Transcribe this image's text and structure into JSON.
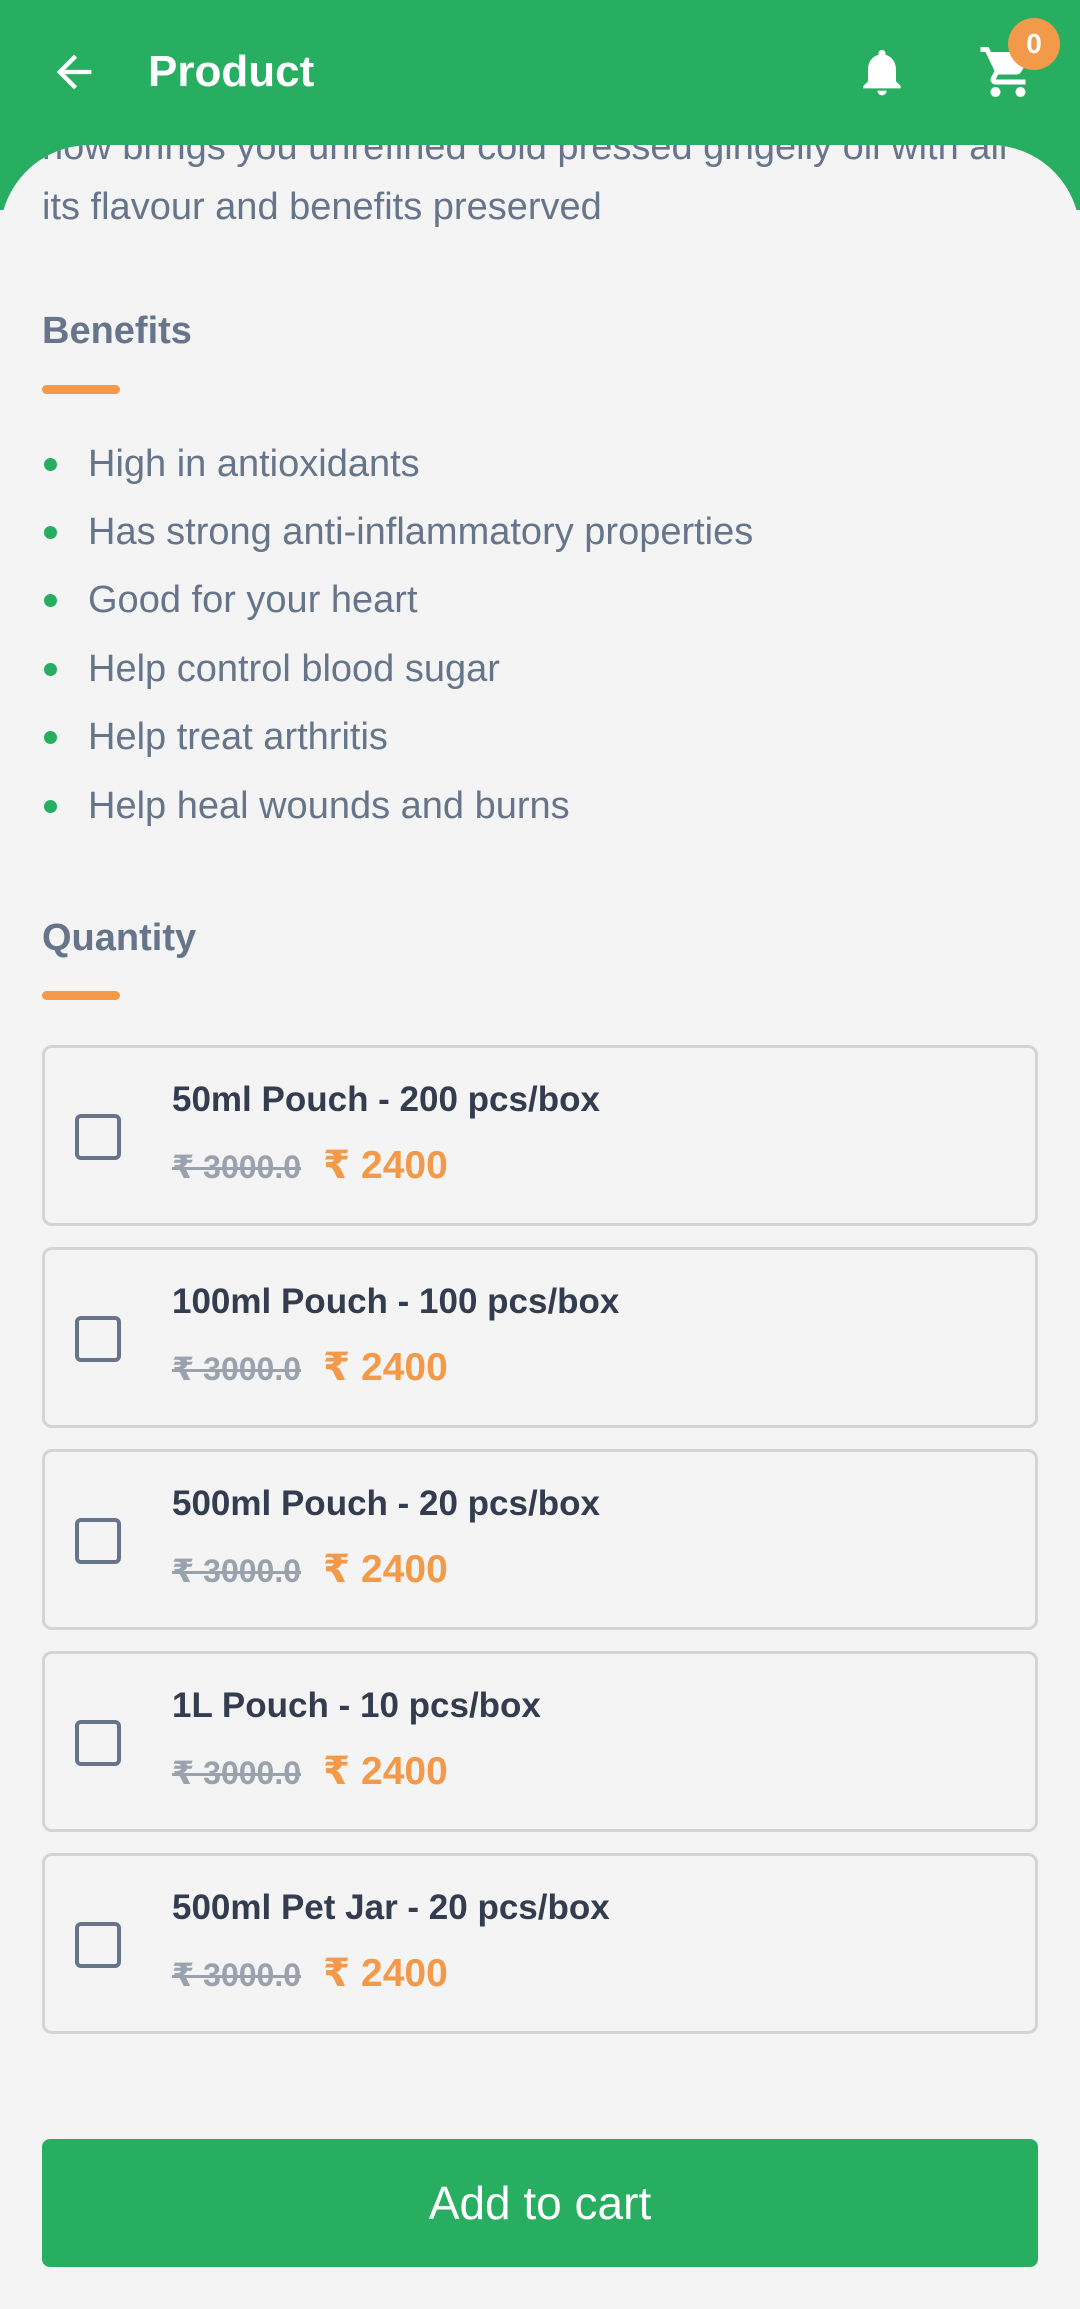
{
  "header": {
    "title": "Product",
    "cart_count": "0",
    "colors": {
      "primary": "#27ae60",
      "accent": "#f2994a"
    }
  },
  "description": {
    "text": "now brings you unrefined cold pressed gingelly oil with all its flavour and benefits preserved"
  },
  "benefits": {
    "title": "Benefits",
    "items": [
      "High in antioxidants",
      "Has strong anti-inflammatory properties",
      "Good for your heart",
      "Help control blood sugar",
      "Help treat arthritis",
      "Help heal wounds and burns"
    ]
  },
  "quantity": {
    "title": "Quantity",
    "options": [
      {
        "name": "50ml Pouch - 200 pcs/box",
        "old_price": "₹ 3000.0",
        "price": "₹ 2400",
        "checked": false
      },
      {
        "name": "100ml Pouch - 100 pcs/box",
        "old_price": "₹ 3000.0",
        "price": "₹ 2400",
        "checked": false
      },
      {
        "name": "500ml Pouch - 20 pcs/box",
        "old_price": "₹ 3000.0",
        "price": "₹ 2400",
        "checked": false
      },
      {
        "name": "1L Pouch - 10 pcs/box",
        "old_price": "₹ 3000.0",
        "price": "₹ 2400",
        "checked": false
      },
      {
        "name": "500ml Pet Jar - 20 pcs/box",
        "old_price": "₹ 3000.0",
        "price": "₹ 2400",
        "checked": false
      }
    ]
  },
  "actions": {
    "add_to_cart": "Add to cart"
  },
  "icons": [
    "arrow-left-icon",
    "bell-icon",
    "cart-icon",
    "bullet-icon",
    "checkbox-icon"
  ]
}
